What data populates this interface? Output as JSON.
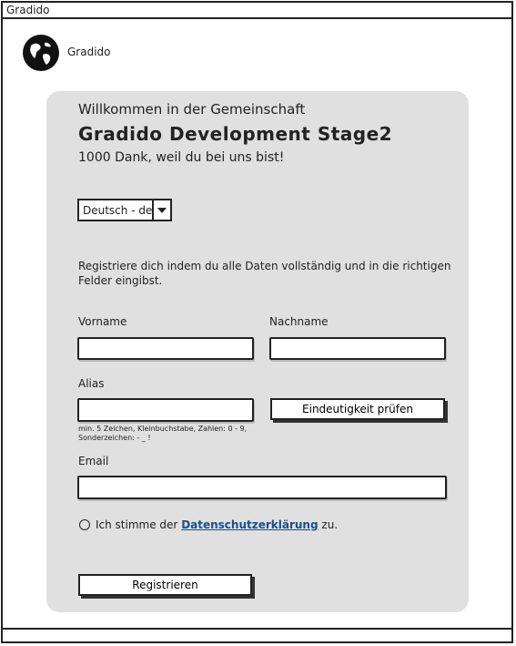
{
  "window": {
    "title": "Gradido"
  },
  "brand": {
    "logo_icon": "globe-icon",
    "name": "Gradido"
  },
  "card": {
    "welcome": "Willkommen in der Gemeinschaft",
    "heading": "Gradido Development Stage2",
    "subheading": "1000 Dank, weil du bei uns bist!",
    "language_select": {
      "value": "Deutsch - de"
    },
    "intro": "Registriere dich indem du alle Daten vollständig und in die richtigen Felder eingibst.",
    "fields": {
      "firstname_label": "Vorname",
      "lastname_label": "Nachname",
      "alias_label": "Alias",
      "alias_hint": "min. 5 Zeichen, Kleinbuchstabe, Zahlen: 0 - 9, Sonderzeichen: - _ !",
      "email_label": "Email"
    },
    "check_button": "Eindeutigkeit prüfen",
    "consent": {
      "prefix": "Ich stimme der",
      "link": "Datenschutzerklärung",
      "suffix": "zu."
    },
    "register_button": "Registrieren"
  }
}
